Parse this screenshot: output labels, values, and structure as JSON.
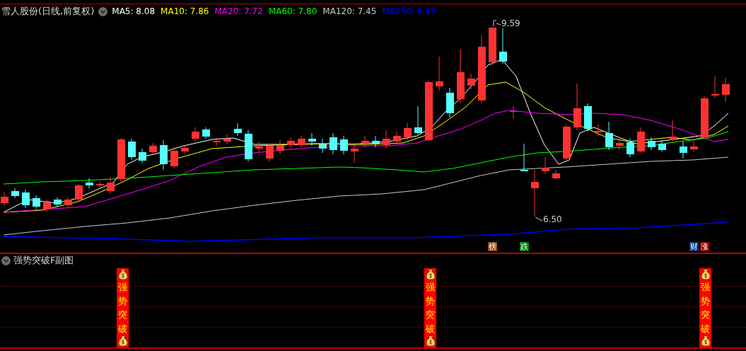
{
  "chart_header": {
    "title": "雪人股份(日线,前复权)",
    "ma_legend": [
      {
        "label": "MA5: 8.08",
        "color": "#ffffff"
      },
      {
        "label": "MA10: 7.86",
        "color": "#ffff00"
      },
      {
        "label": "MA20: 7.72",
        "color": "#ff00ff"
      },
      {
        "label": "MA60: 7.80",
        "color": "#00ff00"
      },
      {
        "label": "MA120: 7.45",
        "color": "#c8c8c8"
      },
      {
        "label": "MA250: 6.45",
        "color": "#0000ff"
      }
    ]
  },
  "price_labels": {
    "high": "9.59",
    "low": "6.50"
  },
  "event_markers": [
    {
      "text": "榜",
      "color": "#8b4a0c"
    },
    {
      "text": "跌",
      "color": "#007a00"
    },
    {
      "text": "财",
      "color": "#0a3a78"
    },
    {
      "text": "涨",
      "color": "#8b0000"
    }
  ],
  "sub_panel": {
    "title": "强势突破F副图",
    "signals": [
      {
        "text": "强势突破"
      },
      {
        "text": "强势突破"
      },
      {
        "text": "强势突破"
      }
    ]
  }
}
